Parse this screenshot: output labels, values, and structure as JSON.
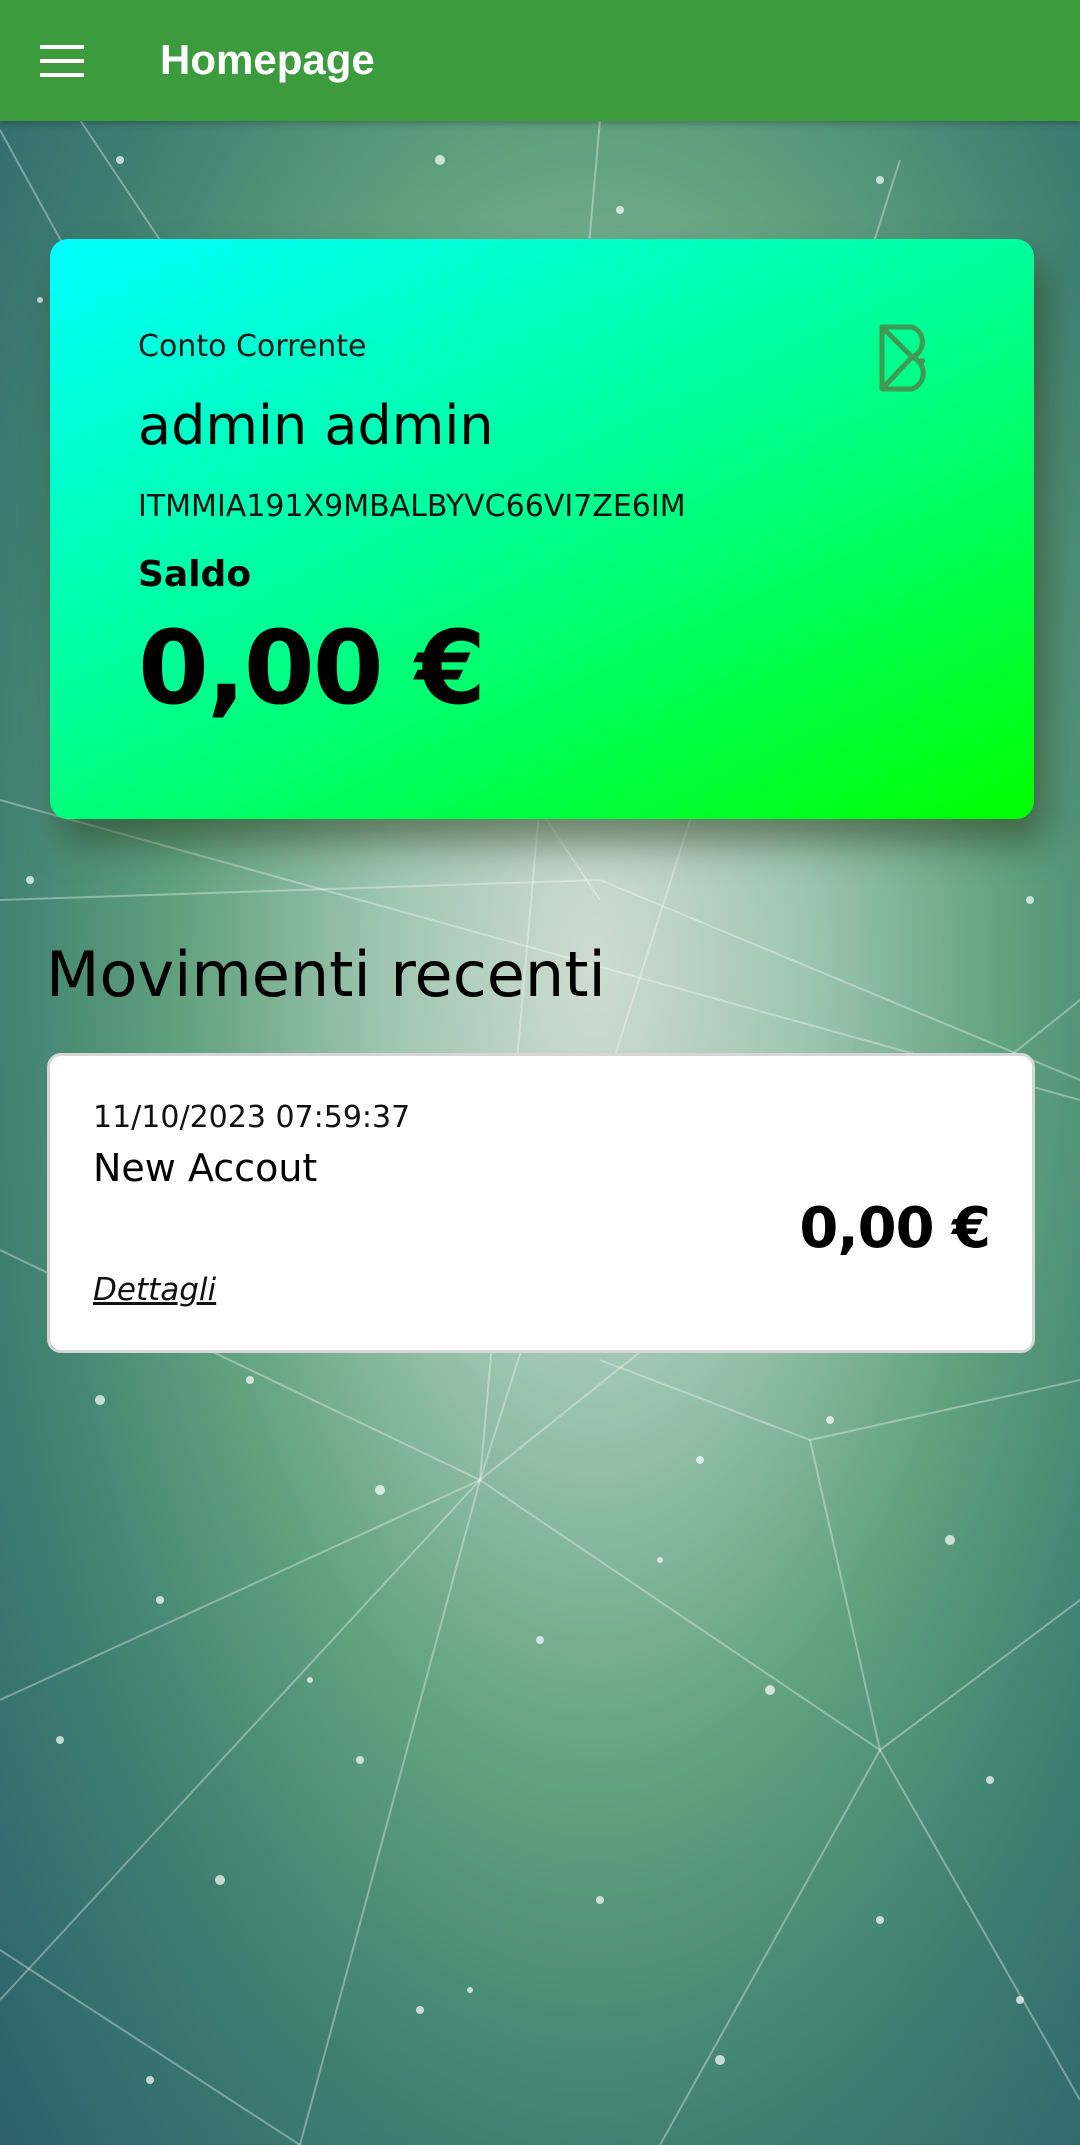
{
  "app_bar": {
    "title": "Homepage",
    "menu_icon": "hamburger-menu-icon",
    "color": "#3c9b3c"
  },
  "account_card": {
    "type_label": "Conto Corrente",
    "owner_name": "admin admin",
    "iban": "ITMMIA191X9MBALBYVC66VI7ZE6IM",
    "balance_label": "Saldo",
    "balance": "0,00 €",
    "logo_icon": "bank-logo-icon",
    "gradient_colors": [
      "#00ffff",
      "#00ff9a",
      "#00ff00"
    ]
  },
  "recent_movements": {
    "title": "Movimenti recenti",
    "items": [
      {
        "date": "11/10/2023 07:59:37",
        "description": "New Accout",
        "amount": "0,00 €",
        "details_link": "Dettagli"
      }
    ]
  }
}
